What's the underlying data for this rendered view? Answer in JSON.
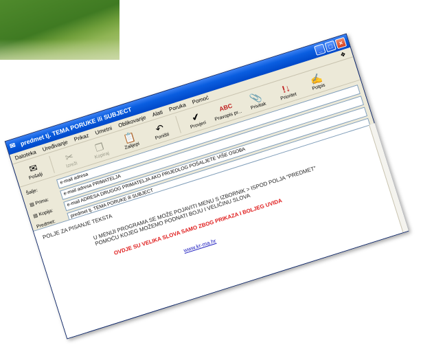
{
  "window": {
    "title": "predmet tj. TEMA PORUKE ili SUBJECT",
    "buttons": {
      "minimize": "_",
      "maximize": "□",
      "close": "×"
    }
  },
  "menu": [
    "Datoteka",
    "Uređivanje",
    "Prikaz",
    "Umetni",
    "Oblikovanje",
    "Alati",
    "Poruka",
    "Pomoć"
  ],
  "toolbar": [
    {
      "label": "Pošalji",
      "icon": "send-icon",
      "glyph": "✉",
      "disabled": false
    },
    {
      "label": "Izreži",
      "icon": "cut-icon",
      "glyph": "✂",
      "disabled": true
    },
    {
      "label": "Kopiraj",
      "icon": "copy-icon",
      "glyph": "❐",
      "disabled": true
    },
    {
      "label": "Zalijepi",
      "icon": "paste-icon",
      "glyph": "📋",
      "disabled": false
    },
    {
      "label": "Poništi",
      "icon": "undo-icon",
      "glyph": "↶",
      "disabled": false
    },
    {
      "label": "Provjeri",
      "icon": "check-names-icon",
      "glyph": "✔",
      "disabled": false
    },
    {
      "label": "Pravopis pr...",
      "icon": "spelling-icon",
      "glyph": "ABC",
      "disabled": false
    },
    {
      "label": "Privitak",
      "icon": "attach-icon",
      "glyph": "📎",
      "disabled": false
    },
    {
      "label": "Prioritet",
      "icon": "priority-icon",
      "glyph": "!↓",
      "disabled": false
    },
    {
      "label": "Potpis",
      "icon": "sign-icon",
      "glyph": "✍",
      "disabled": false
    }
  ],
  "fields": {
    "from": {
      "label": "Šalje:",
      "value": "e-mail adresa"
    },
    "to": {
      "label": "Prima:",
      "value": "e-mail adresa PRIMATELJA"
    },
    "cc": {
      "label": "Kopija:",
      "value": "e-mail ADRESA DRUGOG PRIMATELJA AKO PRIJEDLOG POŠALJETE VIŠE OSOBA"
    },
    "subject": {
      "label": "Predmet:",
      "value": "predmet tj. TEMA PORUKE ili SUBJECT"
    }
  },
  "body": {
    "title": "POLJE ZA PISANJE TEKSTA",
    "line1": "U MENIJI PROGRAMA SE MOŽE POJAVITI MENU S IZBORNIK > ISPOD POLJA \"PREDMET\"",
    "line2": "POMOĆU KOJEG MOŽEMO PODNATI BOJU I VELIČINU SLOVA",
    "red": "OVDJE SU VELIKA SLOVA SAMO ZBOG PRIKAZA I BOLJEG UVIDA",
    "link": "www.kr-ma.hr"
  },
  "colors": {
    "titlebar": "#0a5ee0",
    "red_text": "#e02020",
    "link": "#2020c0"
  }
}
